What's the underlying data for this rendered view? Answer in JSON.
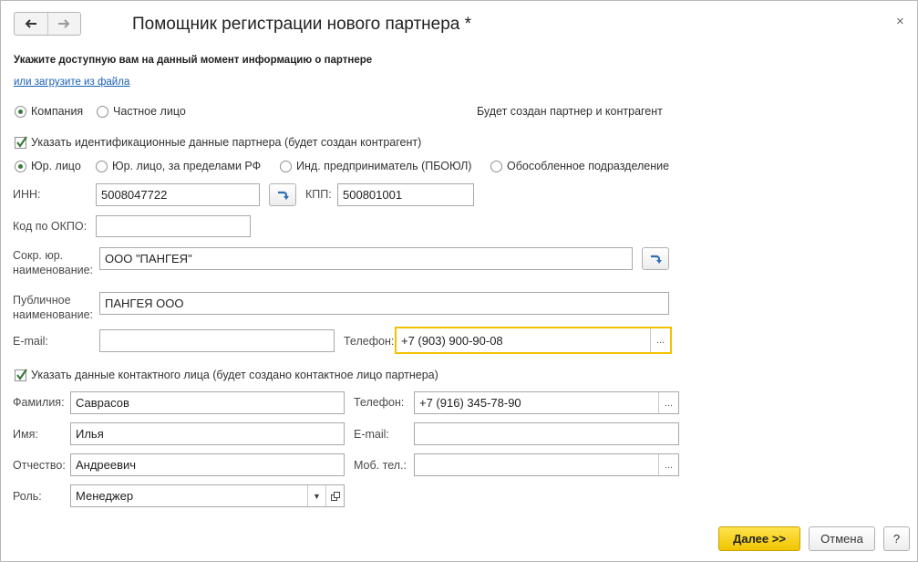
{
  "window": {
    "title": "Помощник регистрации нового партнера *",
    "close_glyph": "×"
  },
  "intro": {
    "heading": "Укажите доступную вам на данный момент информацию о партнере",
    "load_link": "или загрузите из файла"
  },
  "partner_type": {
    "options": [
      "Компания",
      "Частное лицо"
    ],
    "selected": "Компания",
    "note": "Будет создан партнер и контрагент"
  },
  "ident": {
    "checkbox_label": "Указать идентификационные данные партнера (будет создан контрагент)",
    "checked": true,
    "legal_options": [
      "Юр. лицо",
      "Юр. лицо, за пределами РФ",
      "Инд. предприниматель (ПБОЮЛ)",
      "Обособленное подразделение"
    ],
    "legal_selected": "Юр. лицо"
  },
  "fields": {
    "inn_label": "ИНН:",
    "inn_value": "5008047722",
    "kpp_label": "КПП:",
    "kpp_value": "500801001",
    "okpo_label": "Код по ОКПО:",
    "okpo_value": "",
    "short_name_label": "Сокр. юр. наименование:",
    "short_name_value": "ООО \"ПАНГЕЯ\"",
    "public_name_label": "Публичное наименование:",
    "public_name_value": "ПАНГЕЯ ООО",
    "email_label": "E-mail:",
    "email_value": "",
    "phone_label": "Телефон:",
    "phone_value": "+7 (903) 900-90-08",
    "dots": "..."
  },
  "contact": {
    "checkbox_label": "Указать данные контактного лица (будет создано контактное лицо партнера)",
    "checked": true,
    "surname_label": "Фамилия:",
    "surname_value": "Саврасов",
    "name_label": "Имя:",
    "name_value": "Илья",
    "patronymic_label": "Отчество:",
    "patronymic_value": "Андреевич",
    "role_label": "Роль:",
    "role_value": "Менеджер",
    "phone_label": "Телефон:",
    "phone_value": "+7 (916) 345-78-90",
    "email_label": "E-mail:",
    "email_value": "",
    "mobile_label": "Моб. тел.:",
    "mobile_value": ""
  },
  "footer": {
    "next_label": "Далее >>",
    "cancel_label": "Отмена",
    "help_label": "?"
  },
  "colors": {
    "accent": "#f2c200",
    "link": "#1a5fb4",
    "check": "#3a7b3a"
  }
}
